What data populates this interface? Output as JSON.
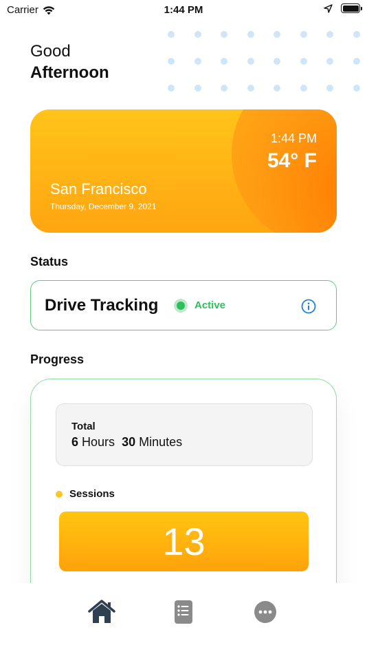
{
  "status_bar": {
    "carrier": "Carrier",
    "time": "1:44 PM",
    "icons": [
      "wifi-icon",
      "location-arrow-icon",
      "battery-icon"
    ]
  },
  "greeting": {
    "line1": "Good",
    "line2": "Afternoon"
  },
  "weather": {
    "time": "1:44 PM",
    "temperature": "54° F",
    "city": "San Francisco",
    "date": "Thursday, December 9, 2021",
    "colors": {
      "top": "#ffc41a",
      "bottom": "#ffa511",
      "sun": "#ff7a00"
    }
  },
  "status": {
    "title": "Status",
    "label": "Drive Tracking",
    "state": "Active",
    "state_color": "#2fbf5a",
    "icon": "info-icon"
  },
  "progress": {
    "title": "Progress",
    "total_label": "Total",
    "hours": "6",
    "hours_unit": "Hours",
    "minutes": "30",
    "minutes_unit": "Minutes",
    "sessions_label": "Sessions",
    "sessions_value": "13"
  },
  "tabs": [
    {
      "name": "home",
      "icon": "home-icon",
      "active": true,
      "color": "#2e4052"
    },
    {
      "name": "list",
      "icon": "list-document-icon",
      "active": false,
      "color": "#888888"
    },
    {
      "name": "more",
      "icon": "more-icon",
      "active": false,
      "color": "#888888"
    }
  ]
}
